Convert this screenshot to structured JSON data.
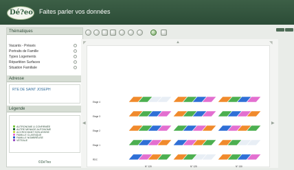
{
  "header": {
    "logo_text": "Dé?eo",
    "tagline": "Faites parler vos données"
  },
  "sidebar": {
    "thematiques_title": "Thématiques",
    "items": [
      {
        "label": "Vacants - Préavis"
      },
      {
        "label": "Portraits de Famille"
      },
      {
        "label": "Types Logements"
      },
      {
        "label": "Répartition Surfaces"
      },
      {
        "label": "Situation Familiale"
      }
    ],
    "adresse_title": "Adresse",
    "address": "RTE DE SAINT JOSEPH",
    "legende_title": "Légende",
    "legend": [
      {
        "label": "AUTRONOME & CONFIRMÉE",
        "color": "#7ac943"
      },
      {
        "label": "AUTRE MENAGE AUTONOME",
        "color": "#1d6b2f"
      },
      {
        "label": "ACCROCHANT SON ASSISE",
        "color": "#c6d84c"
      },
      {
        "label": "FAMILLE CLASSIQUE",
        "color": "#e36fd0"
      },
      {
        "label": "FAMILLE NOMBREUSE",
        "color": "#2f5fcf"
      },
      {
        "label": "VETEALE",
        "color": "#9b4fc4"
      }
    ],
    "copyright": "©Dé?eo"
  },
  "viewer": {
    "floors": [
      "Etage 4",
      "Etage 3",
      "Etage 2",
      "Etage 1",
      "RDC"
    ],
    "columns": [
      "N° 120",
      "N° 125",
      "N° 130"
    ]
  },
  "palette": {
    "orange": "#f08a2c",
    "green": "#4caf50",
    "blue": "#2f6fd6",
    "pink": "#e36fd0",
    "light": "#e8eef5"
  }
}
